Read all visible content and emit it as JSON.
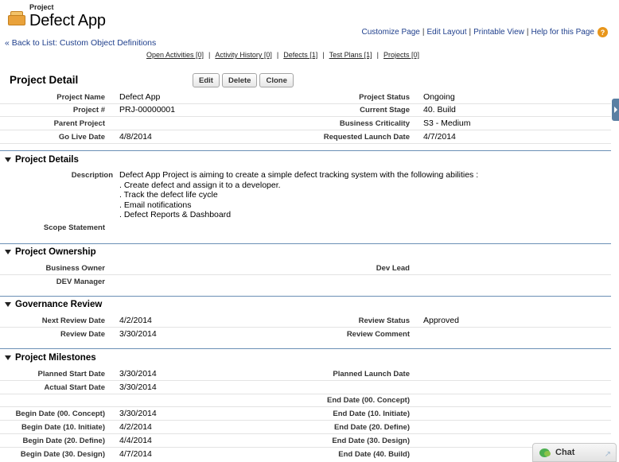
{
  "header": {
    "object_type": "Project",
    "record_name": "Defect App"
  },
  "top_links": [
    "Customize Page",
    "Edit Layout",
    "Printable View",
    "Help for this Page"
  ],
  "back_link": "« Back to List: Custom Object Definitions",
  "related_links": [
    "Open Activities [0]",
    "Activity History [0]",
    "Defects [1]",
    "Test Plans [1]",
    "Projects [0]"
  ],
  "detail": {
    "title": "Project Detail",
    "buttons": {
      "edit": "Edit",
      "delete": "Delete",
      "clone": "Clone"
    },
    "rows": [
      {
        "l1": "Project Name",
        "v1": "Defect App",
        "l2": "Project Status",
        "v2": "Ongoing"
      },
      {
        "l1": "Project #",
        "v1": "PRJ-00000001",
        "l2": "Current Stage",
        "v2": "40. Build"
      },
      {
        "l1": "Parent Project",
        "v1": "",
        "l2": "Business Criticality",
        "v2": "S3 - Medium"
      },
      {
        "l1": "Go Live Date",
        "v1": "4/8/2014",
        "l2": "Requested Launch Date",
        "v2": "4/7/2014"
      }
    ]
  },
  "project_details": {
    "title": "Project Details",
    "description_label": "Description",
    "description_lines": [
      "Defect App Project is aiming to create a simple defect tracking system with the following abilities :",
      ". Create defect and assign it to a developer.",
      ". Track the defect life cycle",
      ". Email notifications",
      ". Defect Reports & Dashboard"
    ],
    "scope_label": "Scope Statement"
  },
  "ownership": {
    "title": "Project Ownership",
    "rows": [
      {
        "l1": "Business Owner",
        "v1": "",
        "l2": "Dev Lead",
        "v2": ""
      },
      {
        "l1": "DEV Manager",
        "v1": "",
        "l2": "",
        "v2": ""
      }
    ]
  },
  "governance": {
    "title": "Governance Review",
    "rows": [
      {
        "l1": "Next Review Date",
        "v1": "4/2/2014",
        "l2": "Review Status",
        "v2": "Approved"
      },
      {
        "l1": "Review Date",
        "v1": "3/30/2014",
        "l2": "Review Comment",
        "v2": ""
      }
    ]
  },
  "milestones": {
    "title": "Project Milestones",
    "rows": [
      {
        "l1": "Planned Start Date",
        "v1": "3/30/2014",
        "l2": "Planned Launch Date",
        "v2": ""
      },
      {
        "l1": "Actual Start Date",
        "v1": "3/30/2014",
        "l2": "",
        "v2": ""
      },
      {
        "l1": "",
        "v1": "",
        "l2": "End Date (00. Concept)",
        "v2": ""
      },
      {
        "l1": "Begin Date (00. Concept)",
        "v1": "3/30/2014",
        "l2": "End Date (10. Initiate)",
        "v2": ""
      },
      {
        "l1": "Begin Date (10. Initiate)",
        "v1": "4/2/2014",
        "l2": "End Date (20. Define)",
        "v2": ""
      },
      {
        "l1": "Begin Date (20. Define)",
        "v1": "4/4/2014",
        "l2": "End Date (30. Design)",
        "v2": ""
      },
      {
        "l1": "Begin Date (30. Design)",
        "v1": "4/7/2014",
        "l2": "End Date (40. Build)",
        "v2": ""
      }
    ]
  },
  "chat": {
    "label": "Chat"
  }
}
